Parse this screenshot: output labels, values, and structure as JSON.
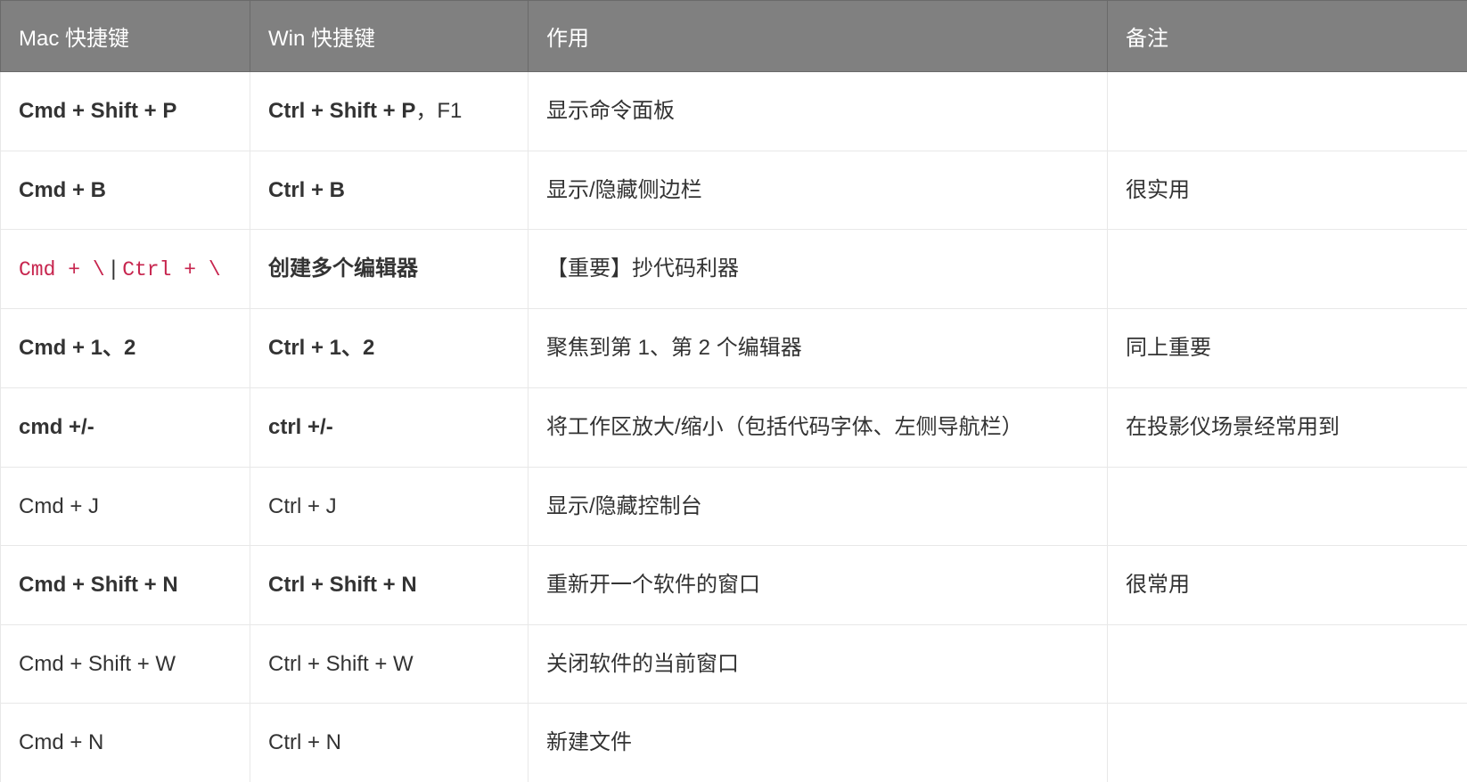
{
  "headers": {
    "mac": "Mac 快捷键",
    "win": "Win 快捷键",
    "function": "作用",
    "note": "备注"
  },
  "rows": [
    {
      "mac": "Cmd + Shift + P",
      "mac_bold": true,
      "win_bold_part": "Ctrl + Shift + P",
      "win_plain_part": "，F1",
      "function": "显示命令面板",
      "note": ""
    },
    {
      "mac": "Cmd + B",
      "mac_bold": true,
      "win": "Ctrl + B",
      "win_bold": true,
      "function": "显示/隐藏侧边栏",
      "note": "很实用"
    },
    {
      "mac_code_a": "Cmd + \\",
      "mac_sep": " | ",
      "mac_code_b": "Ctrl + \\",
      "win": "创建多个编辑器",
      "win_bold": true,
      "function": "【重要】抄代码利器",
      "note": ""
    },
    {
      "mac": "Cmd + 1、2",
      "mac_bold": true,
      "win": "Ctrl + 1、2",
      "win_bold": true,
      "function": "聚焦到第 1、第 2 个编辑器",
      "note": "同上重要"
    },
    {
      "mac": "cmd +/-",
      "mac_bold": true,
      "win": "ctrl +/-",
      "win_bold": true,
      "function": "将工作区放大/缩小（包括代码字体、左侧导航栏）",
      "note": "在投影仪场景经常用到"
    },
    {
      "mac": "Cmd + J",
      "mac_bold": false,
      "win": "Ctrl + J",
      "win_bold": false,
      "function": "显示/隐藏控制台",
      "note": ""
    },
    {
      "mac": "Cmd + Shift + N",
      "mac_bold": true,
      "win": "Ctrl + Shift + N",
      "win_bold": true,
      "function": "重新开一个软件的窗口",
      "note": "很常用"
    },
    {
      "mac": "Cmd + Shift + W",
      "mac_bold": false,
      "win": "Ctrl + Shift + W",
      "win_bold": false,
      "function": "关闭软件的当前窗口",
      "note": ""
    },
    {
      "mac": "Cmd + N",
      "mac_bold": false,
      "win": "Ctrl + N",
      "win_bold": false,
      "function": "新建文件",
      "note": ""
    }
  ]
}
